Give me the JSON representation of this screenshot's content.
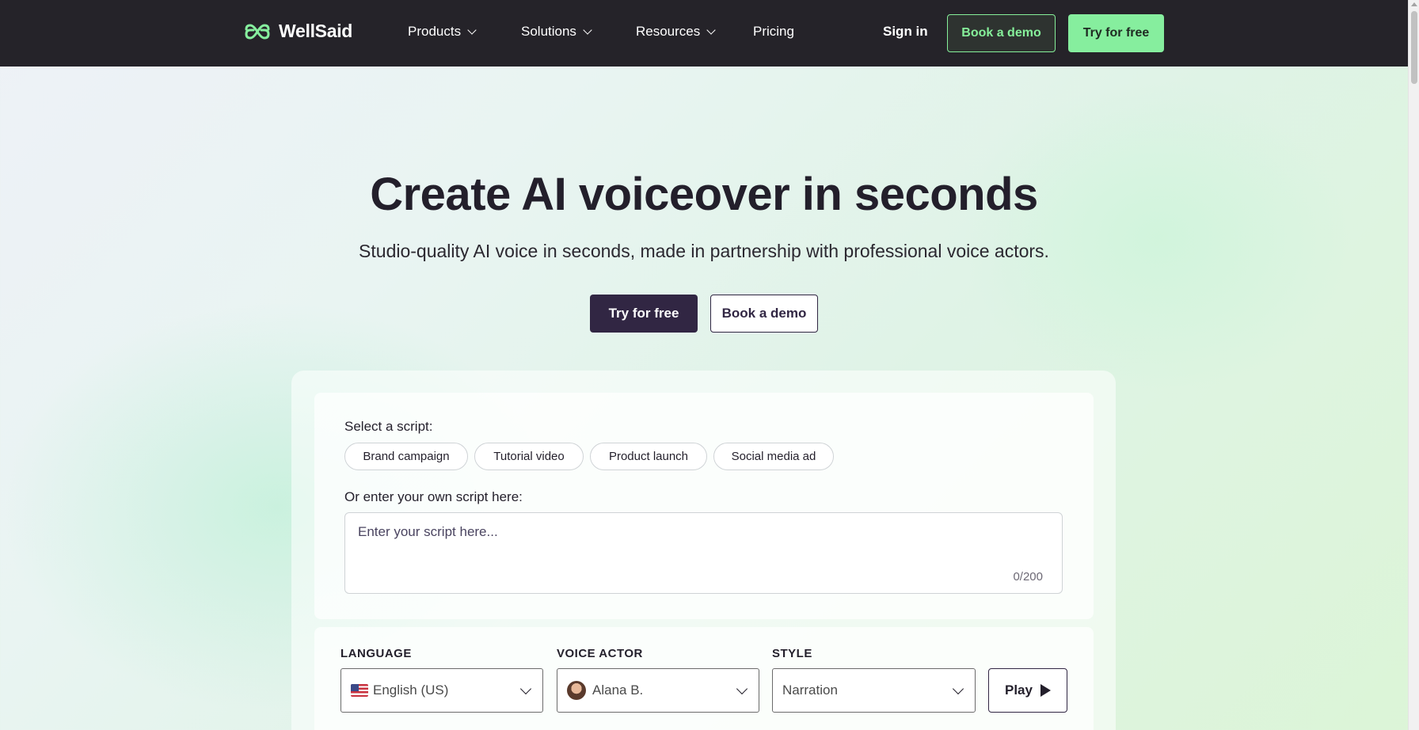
{
  "nav": {
    "logo_text": "WellSaid",
    "items": [
      {
        "label": "Products",
        "has_dropdown": true
      },
      {
        "label": "Solutions",
        "has_dropdown": true
      },
      {
        "label": "Resources",
        "has_dropdown": true
      },
      {
        "label": "Pricing",
        "has_dropdown": false
      }
    ],
    "sign_in": "Sign in",
    "book_demo": "Book a demo",
    "try_free": "Try for free"
  },
  "hero": {
    "title_regular": "Create AI voiceover ",
    "title_bold": "in seconds",
    "subtitle": "Studio-quality AI voice in seconds, made in partnership with professional voice actors.",
    "try_free": "Try for free",
    "book_demo": "Book a demo"
  },
  "demo": {
    "select_script_label": "Select a script:",
    "scripts": [
      "Brand campaign",
      "Tutorial video",
      "Product launch",
      "Social media ad"
    ],
    "own_script_label": "Or enter your own script here:",
    "script_placeholder": "Enter your script here...",
    "char_count": "0/200",
    "language_label": "LANGUAGE",
    "language_value": "English (US)",
    "voice_actor_label": "VOICE ACTOR",
    "voice_actor_value": "Alana B.",
    "style_label": "STYLE",
    "style_value": "Narration",
    "play": "Play"
  },
  "colors": {
    "nav_bg": "#252329",
    "accent_green": "#86ee9e",
    "primary_dark": "#312643"
  }
}
